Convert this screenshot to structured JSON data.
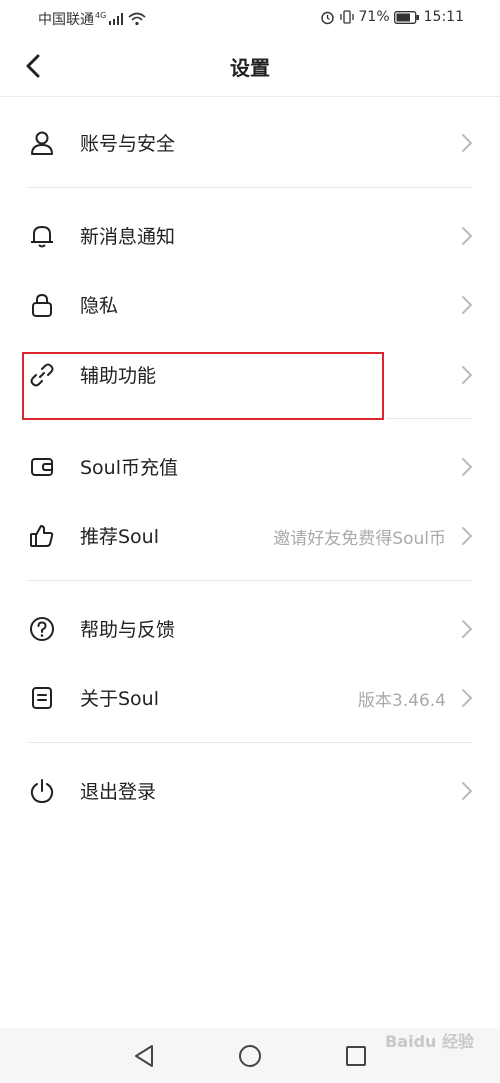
{
  "status_bar": {
    "carrier": "中国联通",
    "network": "4G",
    "battery": "71%",
    "time": "15:11"
  },
  "header": {
    "title": "设置"
  },
  "menu": [
    {
      "label": "账号与安全",
      "sub": "",
      "icon": "user-icon"
    },
    {
      "label": "新消息通知",
      "sub": "",
      "icon": "bell-icon"
    },
    {
      "label": "隐私",
      "sub": "",
      "icon": "lock-icon"
    },
    {
      "label": "辅助功能",
      "sub": "",
      "icon": "link-icon"
    },
    {
      "label": "Soul币充值",
      "sub": "",
      "icon": "wallet-icon"
    },
    {
      "label": "推荐Soul",
      "sub": "邀请好友免费得Soul币",
      "icon": "thumbs-up-icon"
    },
    {
      "label": "帮助与反馈",
      "sub": "",
      "icon": "help-icon"
    },
    {
      "label": "关于Soul",
      "sub": "版本3.46.4",
      "icon": "document-icon"
    },
    {
      "label": "退出登录",
      "sub": "",
      "icon": "power-icon"
    }
  ],
  "highlight_color": "#d9262c",
  "watermark": "Baidu 经验"
}
